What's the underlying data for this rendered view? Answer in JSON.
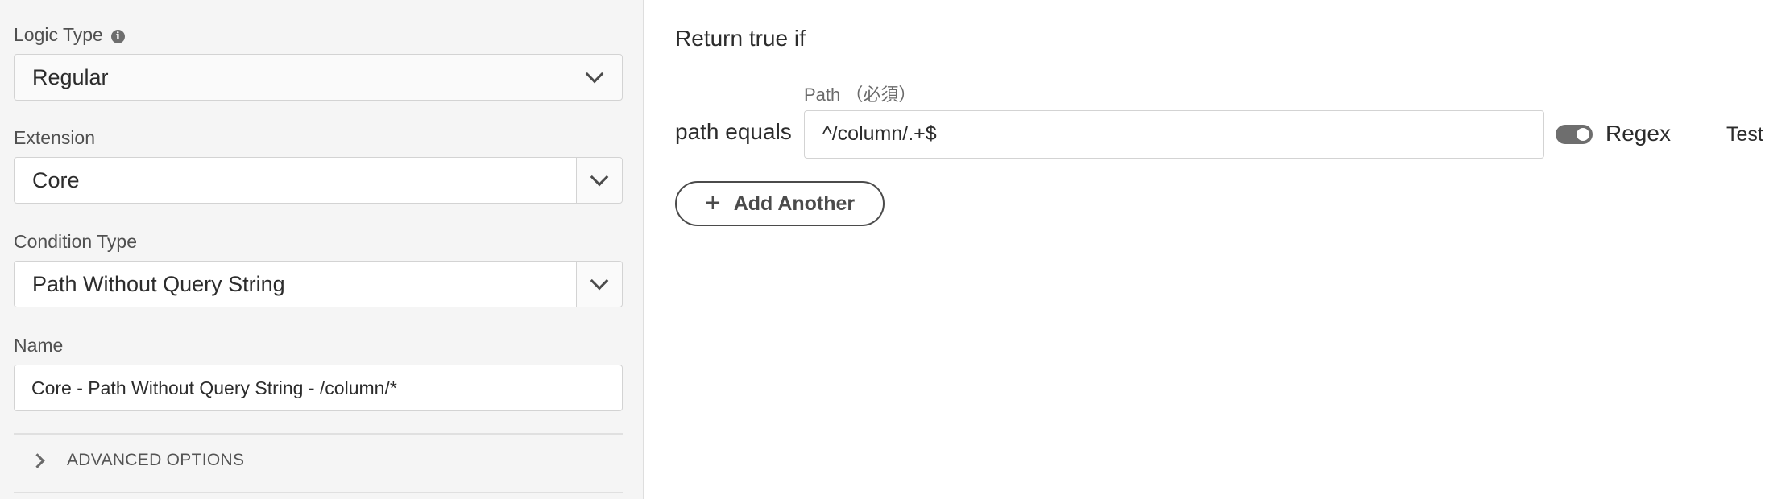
{
  "left": {
    "logic_type": {
      "label": "Logic Type",
      "value": "Regular",
      "icon": "info-icon"
    },
    "extension": {
      "label": "Extension",
      "value": "Core"
    },
    "condition_type": {
      "label": "Condition Type",
      "value": "Path Without Query String"
    },
    "name": {
      "label": "Name",
      "value": "Core - Path Without Query String - /column/*"
    },
    "advanced": {
      "label": "ADVANCED OPTIONS"
    }
  },
  "right": {
    "heading": "Return true if",
    "path_label": "Path （必須）",
    "condition_label": "path equals",
    "path_value": "^/column/.+$",
    "regex_label": "Regex",
    "regex_enabled": true,
    "test_label": "Test",
    "add_another_label": "Add Another"
  }
}
